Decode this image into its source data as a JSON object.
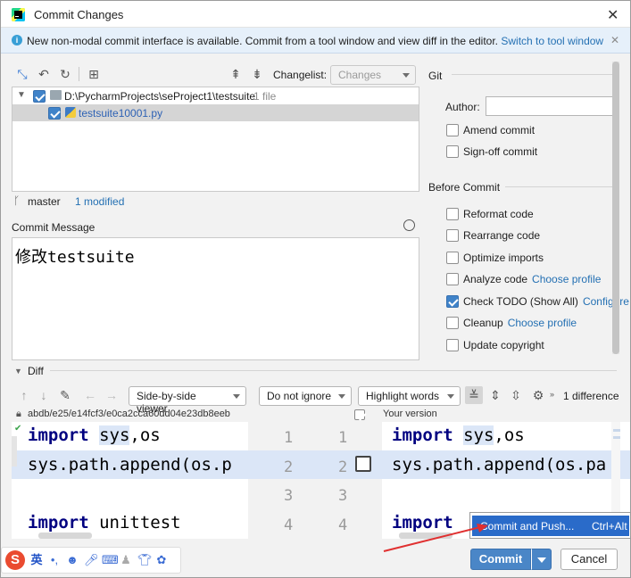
{
  "window": {
    "title": "Commit Changes"
  },
  "banner": {
    "text": "New non-modal commit interface is available. Commit from a tool window and view diff in the editor.",
    "link": "Switch to tool window"
  },
  "changelist": {
    "label": "Changelist:",
    "value": "Changes"
  },
  "tree": {
    "root": {
      "path": "D:\\PycharmProjects\\seProject1\\testsuite",
      "count": "1 file"
    },
    "file": {
      "name": "testsuite10001.py"
    }
  },
  "status": {
    "branch": "master",
    "modified": "1 modified"
  },
  "commit_message": {
    "label": "Commit Message",
    "text": "修改testsuite"
  },
  "git": {
    "section": "Git",
    "author_label": "Author:",
    "author_value": "",
    "amend": "Amend commit",
    "signoff": "Sign-off commit"
  },
  "before_commit": {
    "section": "Before Commit",
    "reformat": "Reformat code",
    "rearrange": "Rearrange code",
    "optimize": "Optimize imports",
    "analyze": "Analyze code",
    "analyze_link": "Choose profile",
    "todo": "Check TODO (Show All)",
    "todo_link": "Configure",
    "cleanup": "Cleanup",
    "cleanup_link": "Choose profile",
    "copyright": "Update copyright"
  },
  "diff": {
    "section": "Diff",
    "viewer": "Side-by-side viewer",
    "ignore": "Do not ignore",
    "highlight": "Highlight words",
    "differences": "1 difference",
    "left_header": "abdb/e25/e14fcf3/e0ca2cca60dd04e23db8eeb",
    "right_header": "Your version",
    "left_lines": [
      "import sys,os",
      "sys.path.append(os.p",
      "",
      "import unittest"
    ],
    "right_lines": [
      "import sys,os",
      "sys.path.append(os.pa",
      "",
      "import"
    ],
    "left_nums": [
      "1",
      "2",
      "3",
      "4"
    ],
    "right_nums": [
      "1",
      "2",
      "3",
      "4"
    ]
  },
  "popup": {
    "item": "Commit and Push...",
    "shortcut": "Ctrl+Alt"
  },
  "buttons": {
    "commit": "Commit",
    "cancel": "Cancel"
  },
  "ime": {
    "lang": "英"
  },
  "colors": {
    "accent": "#4a86c7",
    "highlight": "#dbe6f7",
    "arrow": "#e03030"
  }
}
